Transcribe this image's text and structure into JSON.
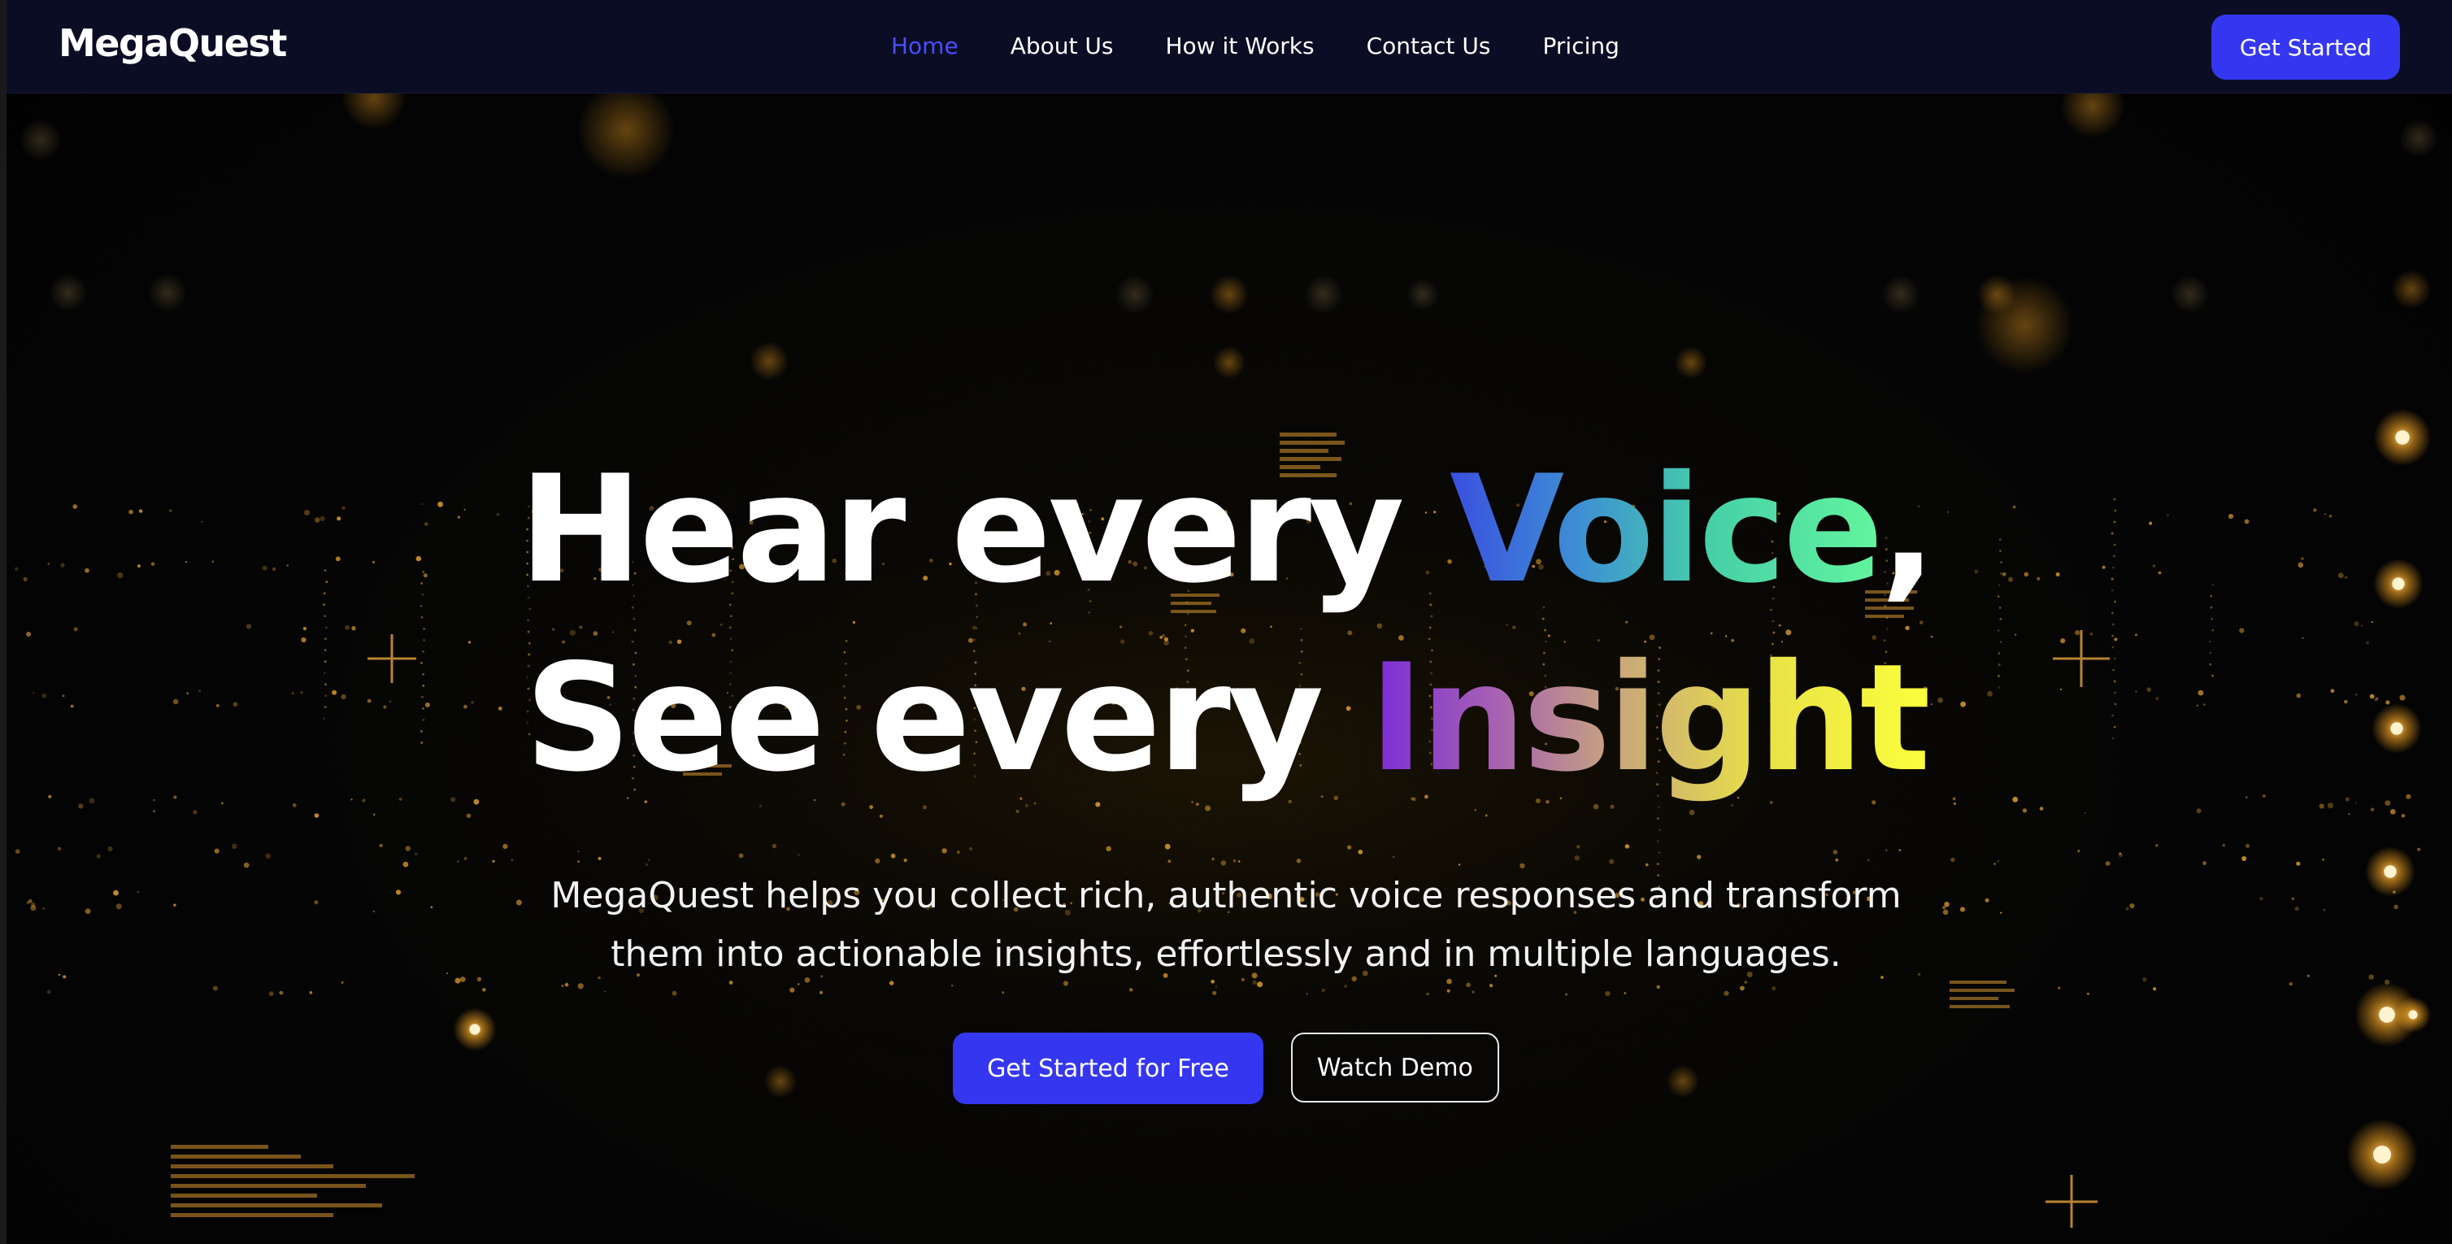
{
  "brand": {
    "name": "MegaQuest"
  },
  "nav": {
    "items": [
      {
        "label": "Home",
        "active": true
      },
      {
        "label": "About Us",
        "active": false
      },
      {
        "label": "How it Works",
        "active": false
      },
      {
        "label": "Contact Us",
        "active": false
      },
      {
        "label": "Pricing",
        "active": false
      }
    ],
    "cta_label": "Get Started"
  },
  "hero": {
    "line1_plain": "Hear every ",
    "line1_highlight": "Voice",
    "line1_tail": ",",
    "line2_plain": "See every ",
    "line2_highlight": "Insight",
    "subtitle_line1": "MegaQuest helps you collect rich, authentic voice responses and transform",
    "subtitle_line2": "them into actionable insights, effortlessly and in multiple languages.",
    "primary_cta": "Get Started for Free",
    "secondary_cta": "Watch Demo"
  },
  "colors": {
    "nav_bg": "#0b0d24",
    "accent": "#3537f0",
    "active_link": "#4a4dff",
    "voice_gradient": [
      "#3a4fe0",
      "#46cfa8",
      "#63f59d"
    ],
    "insight_gradient": [
      "#7b2bd8",
      "#c9a87a",
      "#fbff3c"
    ],
    "particles": "#f5a524"
  }
}
